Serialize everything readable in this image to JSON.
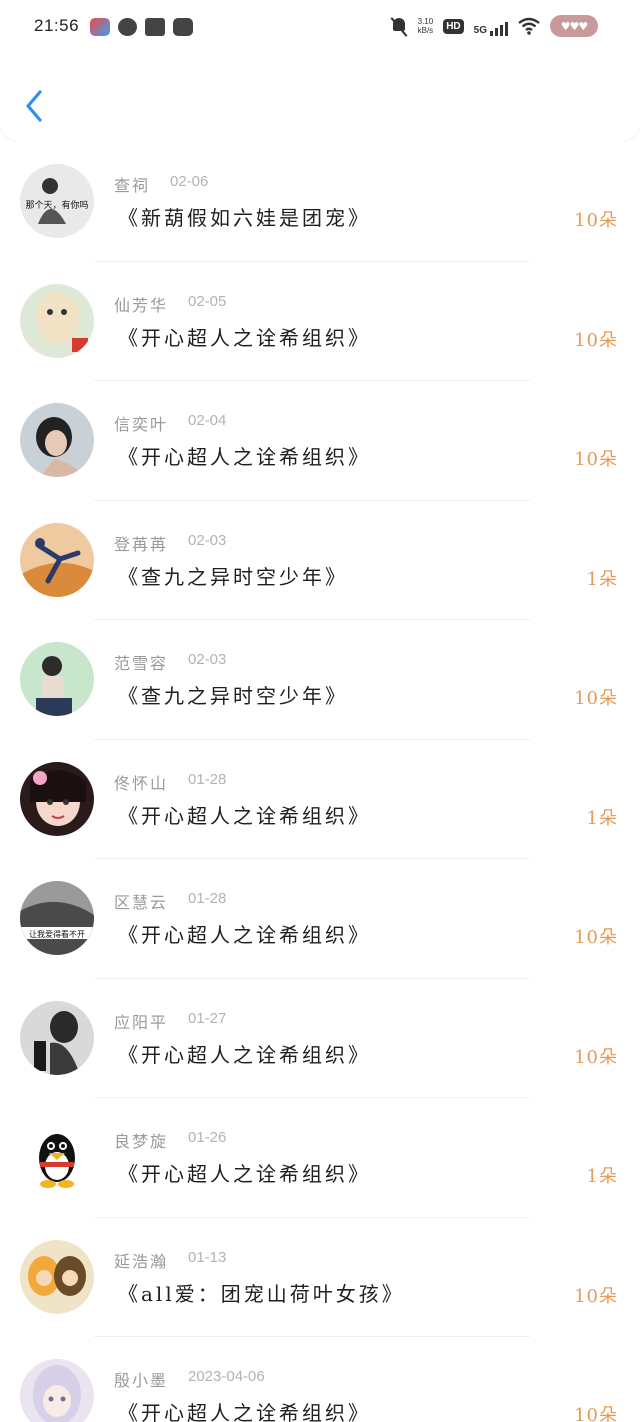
{
  "status_bar": {
    "time": "21:56",
    "net_speed_value": "3.10",
    "net_speed_unit": "kB/s",
    "hd_label": "HD",
    "network_label": "5G",
    "icons": [
      "app-icon",
      "chat-bubble-icon",
      "book-icon",
      "music-icon",
      "mute-icon",
      "wifi-icon",
      "battery-icon"
    ]
  },
  "header": {
    "back_icon": "chevron-left-icon",
    "accent_color": "#2b8ff2"
  },
  "colors": {
    "count": "#e89a55",
    "name": "#9a9a9a",
    "date": "#b3b3b3",
    "title": "#1f1f1f"
  },
  "items": [
    {
      "name": "查祠",
      "date": "02-06",
      "title": "《新葫假如六娃是团宠》",
      "count": "10朵",
      "avatar": "那个天，有你吗"
    },
    {
      "name": "仙芳华",
      "date": "02-05",
      "title": "《开心超人之诠希组织》",
      "count": "10朵",
      "avatar": ""
    },
    {
      "name": "信奕叶",
      "date": "02-04",
      "title": "《开心超人之诠希组织》",
      "count": "10朵",
      "avatar": ""
    },
    {
      "name": "登苒苒",
      "date": "02-03",
      "title": "《查九之异时空少年》",
      "count": "1朵",
      "avatar": ""
    },
    {
      "name": "范雪容",
      "date": "02-03",
      "title": "《查九之异时空少年》",
      "count": "10朵",
      "avatar": ""
    },
    {
      "name": "佟怀山",
      "date": "01-28",
      "title": "《开心超人之诠希组织》",
      "count": "1朵",
      "avatar": ""
    },
    {
      "name": "区慧云",
      "date": "01-28",
      "title": "《开心超人之诠希组织》",
      "count": "10朵",
      "avatar": "让我爱得看不开"
    },
    {
      "name": "应阳平",
      "date": "01-27",
      "title": "《开心超人之诠希组织》",
      "count": "10朵",
      "avatar": ""
    },
    {
      "name": "良梦旋",
      "date": "01-26",
      "title": "《开心超人之诠希组织》",
      "count": "1朵",
      "avatar": ""
    },
    {
      "name": "延浩瀚",
      "date": "01-13",
      "title": "《all爱：团宠山荷叶女孩》",
      "count": "10朵",
      "avatar": ""
    },
    {
      "name": "殷小墨",
      "date": "2023-04-06",
      "title": "《开心超人之诠希组织》",
      "count": "10朵",
      "avatar": ""
    }
  ]
}
